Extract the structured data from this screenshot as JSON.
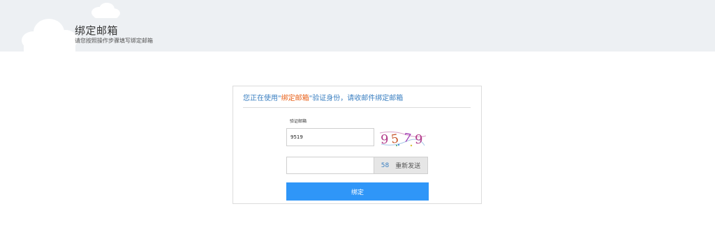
{
  "header": {
    "title": "绑定邮箱",
    "subtitle": "请您按照操作步骤填写绑定邮箱"
  },
  "notice": {
    "prefix": "您正在使用\"",
    "method": "绑定邮箱",
    "suffix": "\"验证身份，请收邮件绑定邮箱"
  },
  "form": {
    "field_label": "验证邮箱",
    "captcha_value": "9519",
    "captcha_image_text": "9579",
    "code_value": "",
    "resend_countdown": "58",
    "resend_label": "重新发送",
    "submit_label": "绑定"
  },
  "colors": {
    "header_bg": "#edf0f3",
    "link_blue": "#3a7fc1",
    "highlight_orange": "#e8611a",
    "button_blue": "#2f96f8"
  }
}
